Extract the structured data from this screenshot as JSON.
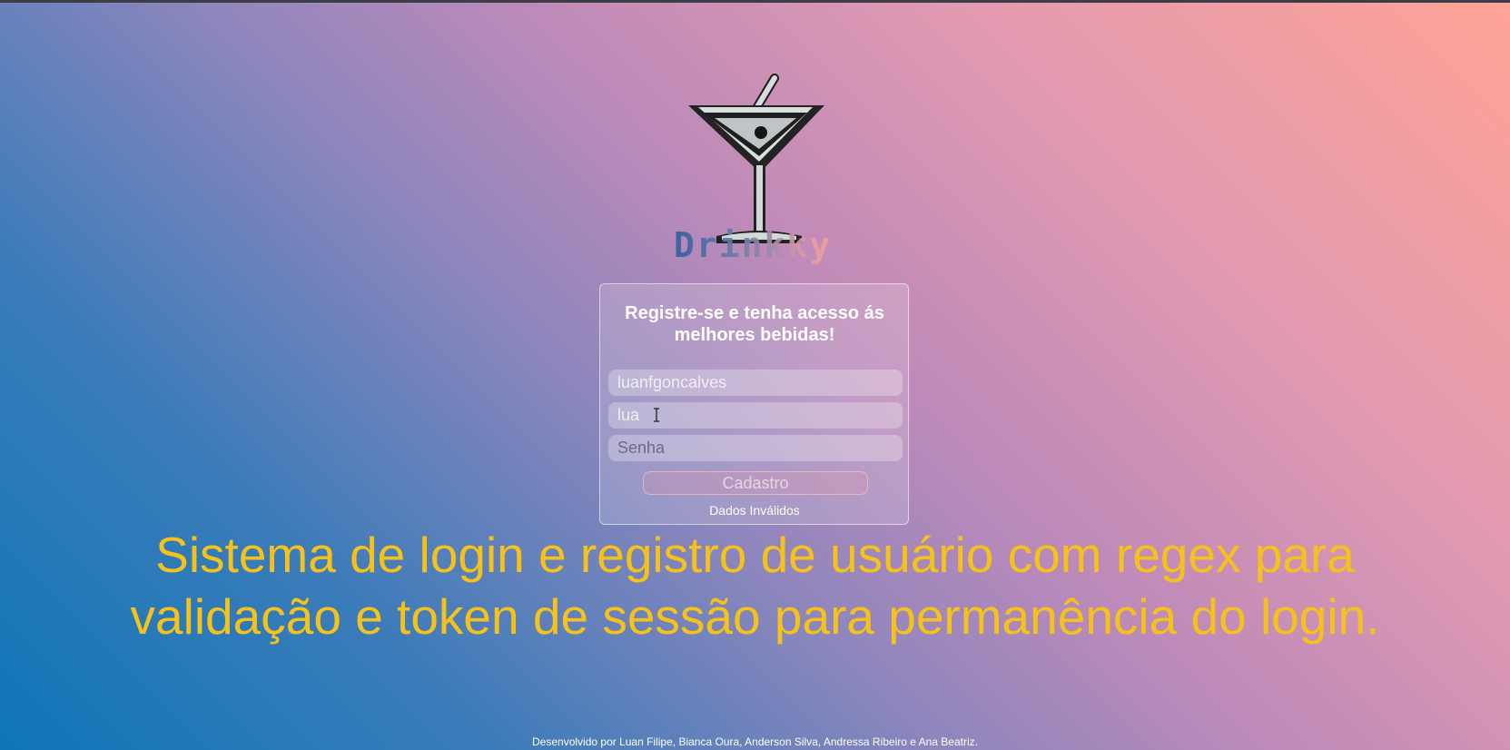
{
  "colors": {
    "headline": "#f5c21b",
    "card_text": "#ffffff",
    "gradient_start": "#0f76b8",
    "gradient_end": "#ffa396"
  },
  "logo": {
    "icon": "martini-glass-icon",
    "brand_name": "Drinkky"
  },
  "register_form": {
    "title": "Registre-se e tenha acesso ás melhores bebidas!",
    "username_value": "luanfgoncalves",
    "email_value": "lua",
    "password_placeholder": "Senha",
    "submit_label": "Cadastro",
    "error_message": "Dados Inválidos"
  },
  "headline": "Sistema de login e registro de usuário com regex para validação e token de sessão para permanência do login.",
  "footer": "Desenvolvido por Luan Filipe, Bianca Oura, Anderson Silva, Andressa Ribeiro e Ana Beatriz."
}
